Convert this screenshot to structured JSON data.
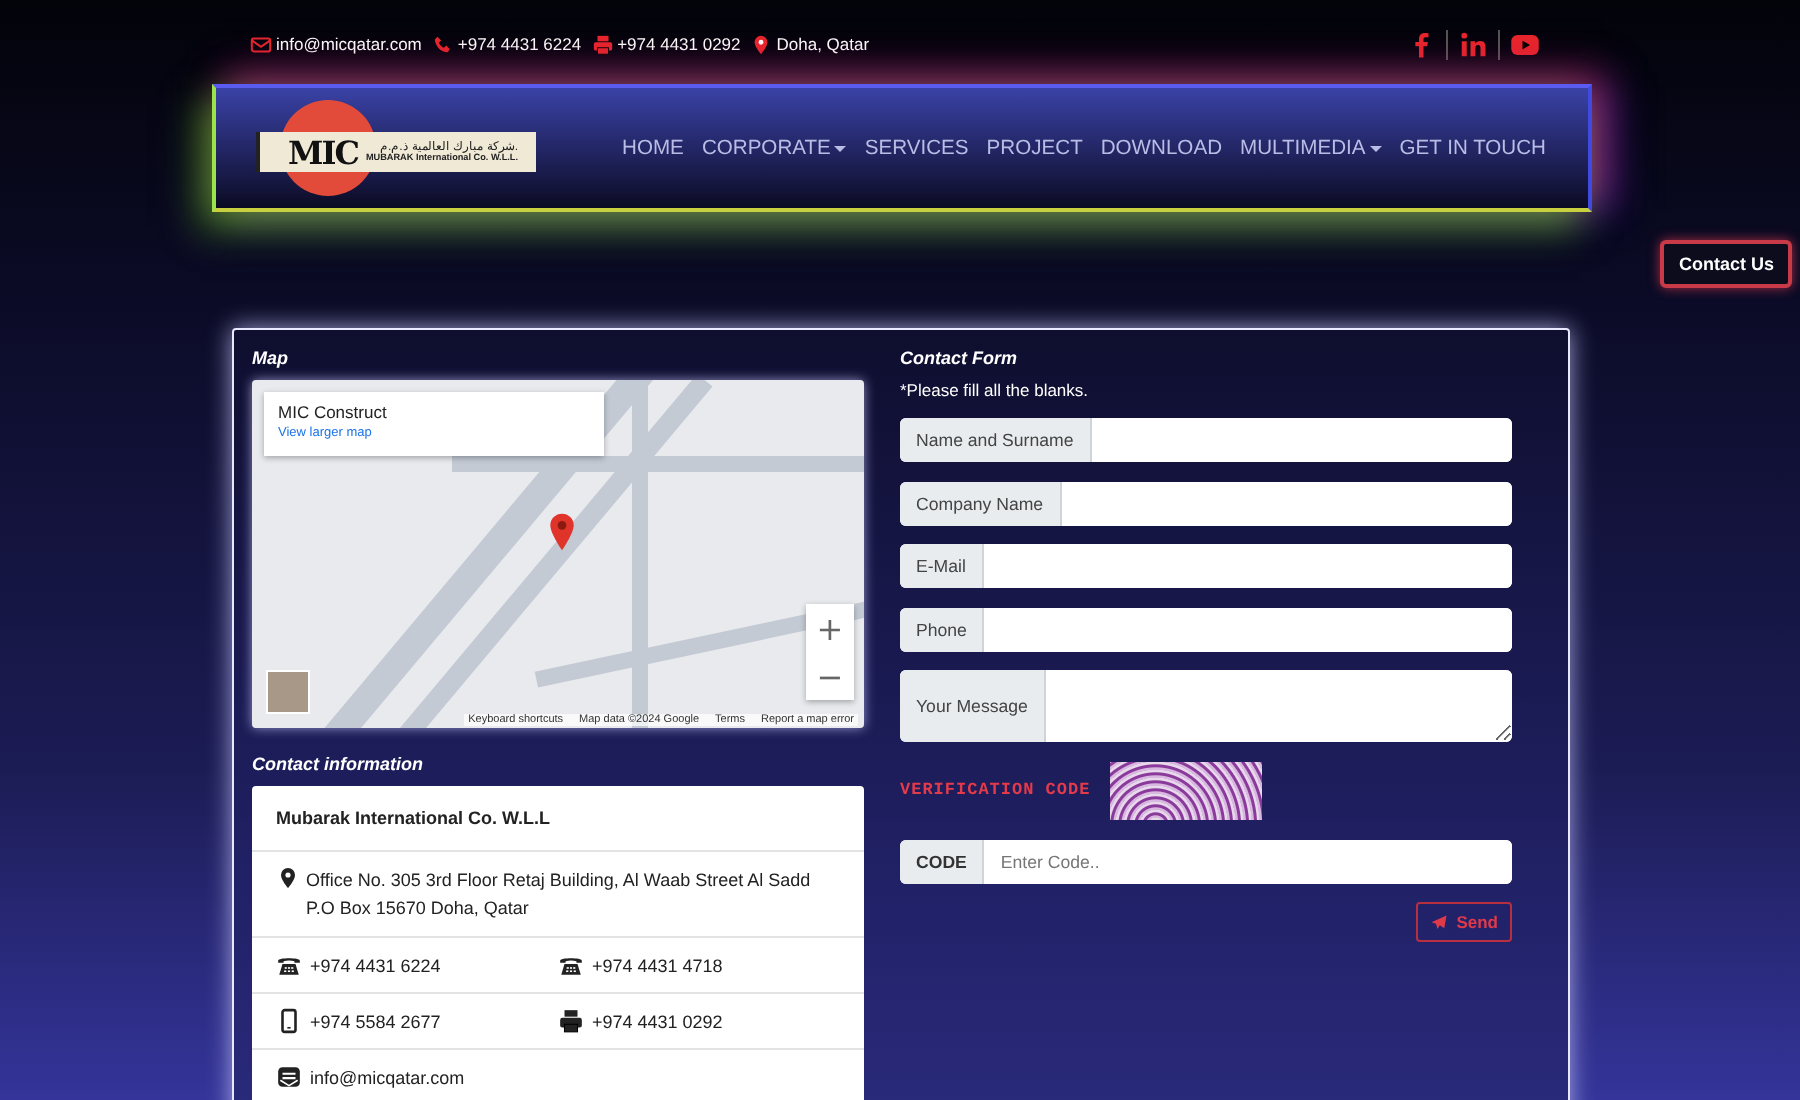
{
  "topbar": {
    "contacts": [
      {
        "kind": "email",
        "text": "info@micqatar.com"
      },
      {
        "kind": "phone",
        "text": "+974 4431 6224"
      },
      {
        "kind": "fax",
        "text": "+974 4431 0292"
      },
      {
        "kind": "location",
        "text": "Doha, Qatar"
      }
    ],
    "social": [
      {
        "kind": "facebook"
      },
      {
        "kind": "linkedin"
      },
      {
        "kind": "youtube"
      }
    ]
  },
  "logo": {
    "mark": "MIC",
    "arabic": "شركة مبارك العالمية ذ.م.م.",
    "english": "MUBARAK International Co. W.L.L."
  },
  "nav": [
    {
      "label": "HOME",
      "dropdown": false
    },
    {
      "label": "CORPORATE",
      "dropdown": true
    },
    {
      "label": "SERVICES",
      "dropdown": false
    },
    {
      "label": "PROJECT",
      "dropdown": false
    },
    {
      "label": "DOWNLOAD",
      "dropdown": false
    },
    {
      "label": "MULTIMEDIA",
      "dropdown": true
    },
    {
      "label": "GET IN TOUCH",
      "dropdown": false
    }
  ],
  "floating_button": "Contact Us",
  "map": {
    "title": "Map",
    "place": "MIC Construct",
    "link": "View larger map",
    "zoom_in": "+",
    "zoom_out": "−",
    "footer": [
      "Keyboard shortcuts",
      "Map data ©2024 Google",
      "Terms",
      "Report a map error"
    ]
  },
  "contact_info": {
    "title": "Contact information",
    "company": "Mubarak International Co. W.L.L",
    "address": "Office No. 305 3rd Floor Retaj Building, Al Waab Street Al Sadd P.O Box 15670 Doha, Qatar",
    "rows": [
      [
        {
          "kind": "telephone",
          "text": "+974 4431 6224"
        },
        {
          "kind": "telephone",
          "text": "+974 4431 4718"
        }
      ],
      [
        {
          "kind": "mobile",
          "text": "+974 5584 2677"
        },
        {
          "kind": "fax",
          "text": "+974 4431 0292"
        }
      ],
      [
        {
          "kind": "email",
          "text": "info@micqatar.com"
        }
      ]
    ]
  },
  "form": {
    "title": "Contact Form",
    "note": "*Please fill all the blanks.",
    "fields": [
      {
        "kind": "input",
        "label": "Name and Surname"
      },
      {
        "kind": "input",
        "label": "Company Name"
      },
      {
        "kind": "input",
        "label": "E-Mail"
      },
      {
        "kind": "input",
        "label": "Phone"
      },
      {
        "kind": "textarea",
        "label": "Your Message"
      }
    ],
    "verification_label": "VERIFICATION CODE",
    "code": {
      "label": "CODE",
      "placeholder": "Enter Code.."
    },
    "send": "Send"
  }
}
